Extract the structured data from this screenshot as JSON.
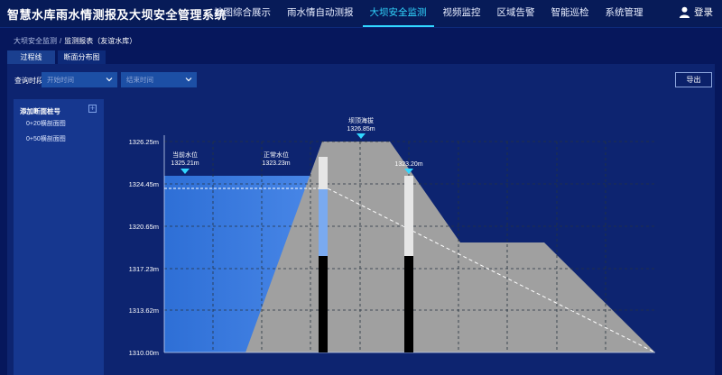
{
  "app_title": "智慧水库雨水情测报及大坝安全管理系统",
  "nav": [
    "地图综合展示",
    "雨水情自动测报",
    "大坝安全监测",
    "视频监控",
    "区域告警",
    "智能巡检",
    "系统管理"
  ],
  "nav_active_index": 2,
  "login_label": "登录",
  "breadcrumb": {
    "parent": "大坝安全监测",
    "sep": "/",
    "current": "监测报表（友谊水库）"
  },
  "tabs": [
    "过程线",
    "断面分布图"
  ],
  "active_tab_index": 1,
  "filter": {
    "label": "查询时段",
    "start_placeholder": "开始时间",
    "end_placeholder": "结束时间"
  },
  "export_label": "导出",
  "sidebar": {
    "title": "添加断面桩号",
    "items": [
      "0+20横剖面图",
      "0+50横剖面图"
    ]
  },
  "colors": {
    "water": "#3f7fe0",
    "dam": "#a0a0a0",
    "accent": "#31d7ff",
    "background": "#06175c"
  },
  "chart_data": {
    "type": "area",
    "y_ticks": [
      "1326.25m",
      "1324.45m",
      "1320.65m",
      "1317.23m",
      "1313.62m",
      "1310.00m"
    ],
    "annotations": [
      {
        "label": "坝顶海拔",
        "value": "1326.85m"
      },
      {
        "label": "当前水位",
        "value": "1325.21m"
      },
      {
        "label": "正常水位",
        "value": "1323.23m"
      },
      {
        "label": "",
        "value": "1323.20m"
      }
    ],
    "grid": true
  }
}
